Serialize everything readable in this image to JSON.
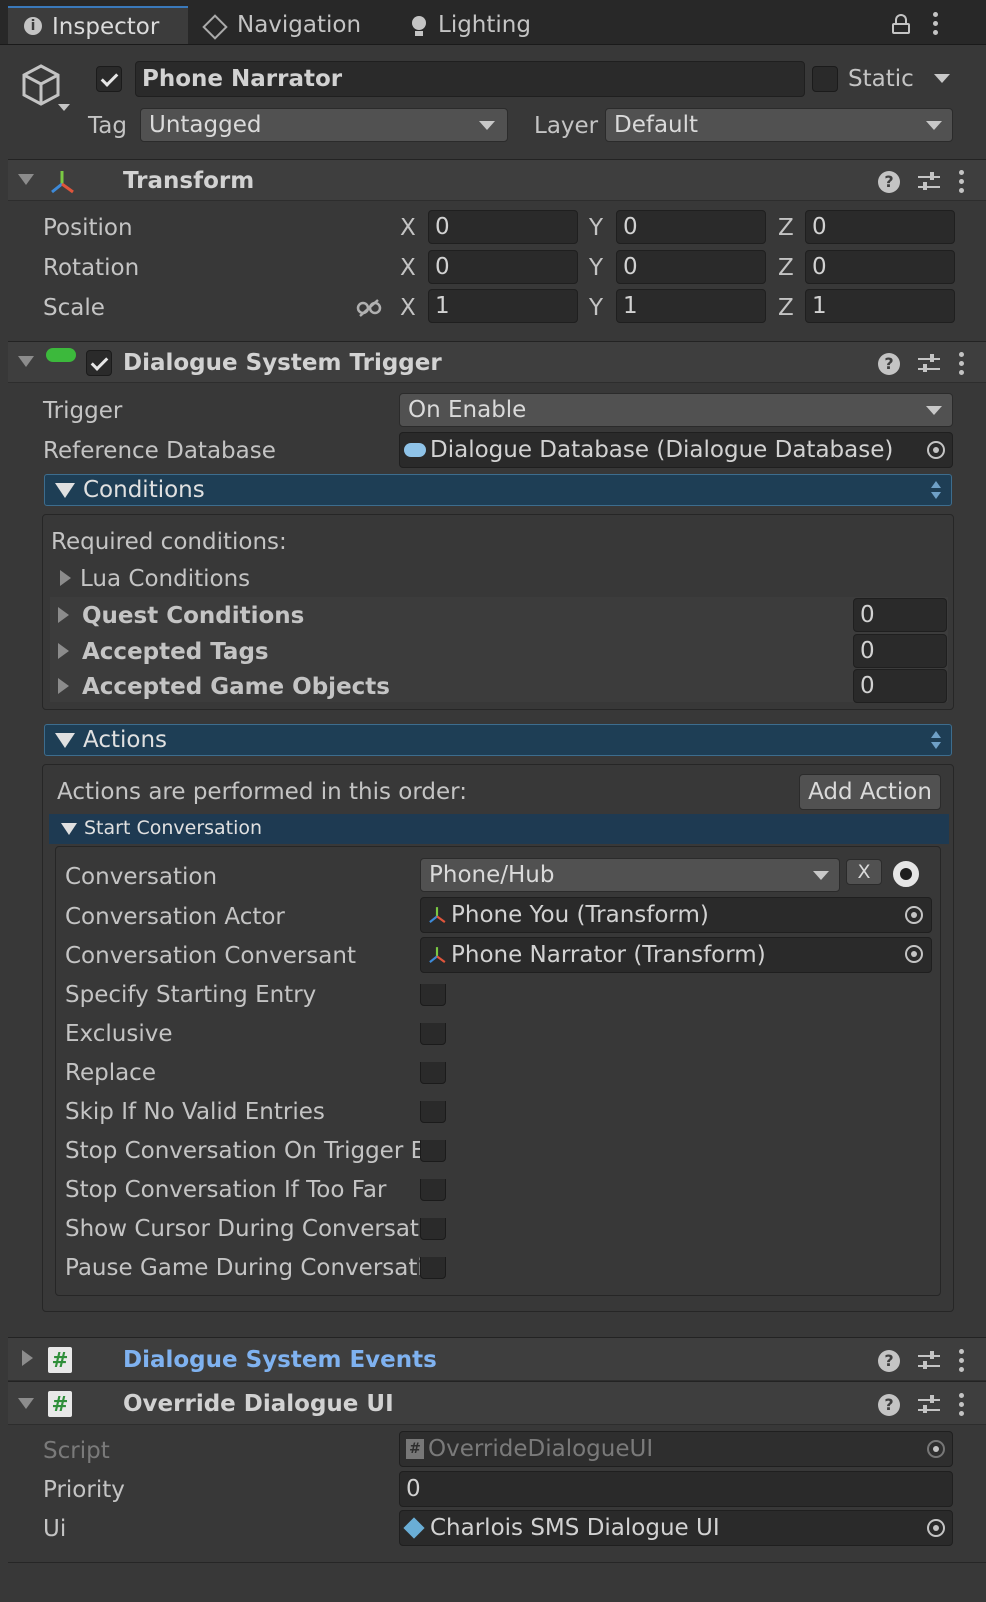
{
  "tabs": [
    {
      "label": "Inspector",
      "active": true
    },
    {
      "label": "Navigation",
      "active": false
    },
    {
      "label": "Lighting",
      "active": false
    }
  ],
  "object": {
    "name": "Phone Narrator",
    "active": true,
    "static_label": "Static",
    "tag_label": "Tag",
    "tag_value": "Untagged",
    "layer_label": "Layer",
    "layer_value": "Default"
  },
  "transform": {
    "title": "Transform",
    "rows": [
      {
        "label": "Position",
        "x": "0",
        "y": "0",
        "z": "0"
      },
      {
        "label": "Rotation",
        "x": "0",
        "y": "0",
        "z": "0"
      },
      {
        "label": "Scale",
        "x": "1",
        "y": "1",
        "z": "1"
      }
    ],
    "axis": {
      "x": "X",
      "y": "Y",
      "z": "Z"
    }
  },
  "dst": {
    "title": "Dialogue System Trigger",
    "enabled": true,
    "trigger_label": "Trigger",
    "trigger_value": "On Enable",
    "refdb_label": "Reference Database",
    "refdb_value": "Dialogue Database (Dialogue Database)",
    "conditions": {
      "title": "Conditions",
      "required_label": "Required conditions:",
      "lua_label": "Lua Conditions",
      "quest_label": "Quest Conditions",
      "quest_count": "0",
      "tags_label": "Accepted Tags",
      "tags_count": "0",
      "objects_label": "Accepted Game Objects",
      "objects_count": "0"
    },
    "actions": {
      "title": "Actions",
      "order_label": "Actions are performed in this order:",
      "add_label": "Add Action",
      "start_conv": {
        "title": "Start Conversation",
        "conversation_label": "Conversation",
        "conversation_value": "Phone/Hub",
        "clear_label": "X",
        "actor_label": "Conversation Actor",
        "actor_value": "Phone You (Transform)",
        "conversant_label": "Conversation Conversant",
        "conversant_value": "Phone Narrator (Transform)",
        "checkbox_rows": [
          {
            "label": "Specify Starting Entry",
            "checked": false
          },
          {
            "label": "Exclusive",
            "checked": false
          },
          {
            "label": "Replace",
            "checked": false
          },
          {
            "label": "Skip If No Valid Entries",
            "checked": false
          },
          {
            "label": "Stop Conversation On Trigger Ex",
            "checked": false
          },
          {
            "label": "Stop Conversation If Too Far",
            "checked": false
          },
          {
            "label": "Show Cursor During Conversatic",
            "checked": false
          },
          {
            "label": "Pause Game During Conversatic",
            "checked": false
          }
        ]
      }
    }
  },
  "events": {
    "title": "Dialogue System Events"
  },
  "override": {
    "title": "Override Dialogue UI",
    "script_label": "Script",
    "script_value": "OverrideDialogueUI",
    "priority_label": "Priority",
    "priority_value": "0",
    "ui_label": "Ui",
    "ui_value": "Charlois SMS Dialogue UI"
  },
  "colors": {
    "background": "#383838",
    "header": "#3e3e3e",
    "accent_blue": "#1e3e55",
    "link_blue": "#7fb2f0"
  }
}
